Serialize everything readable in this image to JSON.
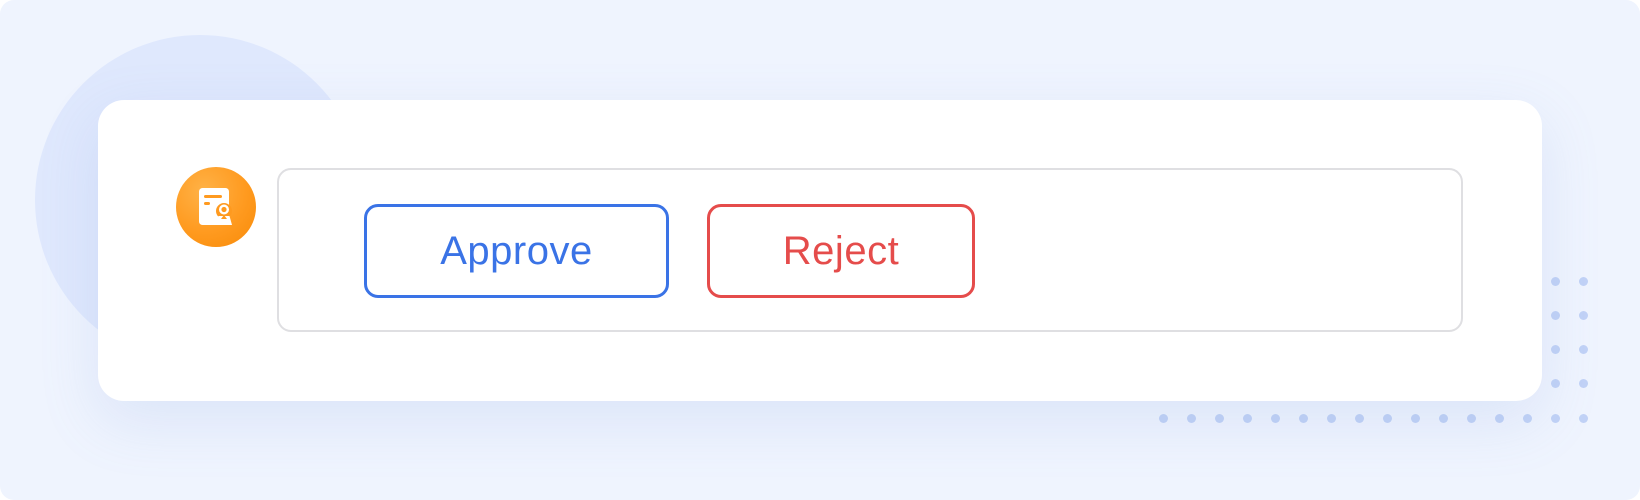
{
  "actions": {
    "approve_label": "Approve",
    "reject_label": "Reject"
  },
  "avatar": {
    "icon": "document-certificate-icon"
  },
  "colors": {
    "page_background": "#eff4fe",
    "decor_circle": "#dfe8fd",
    "card_background": "#ffffff",
    "approve_accent": "#3a73e6",
    "reject_accent": "#e54c4b",
    "avatar_orange": "#ff9a1f",
    "decor_dots": "#c1d2f6"
  }
}
